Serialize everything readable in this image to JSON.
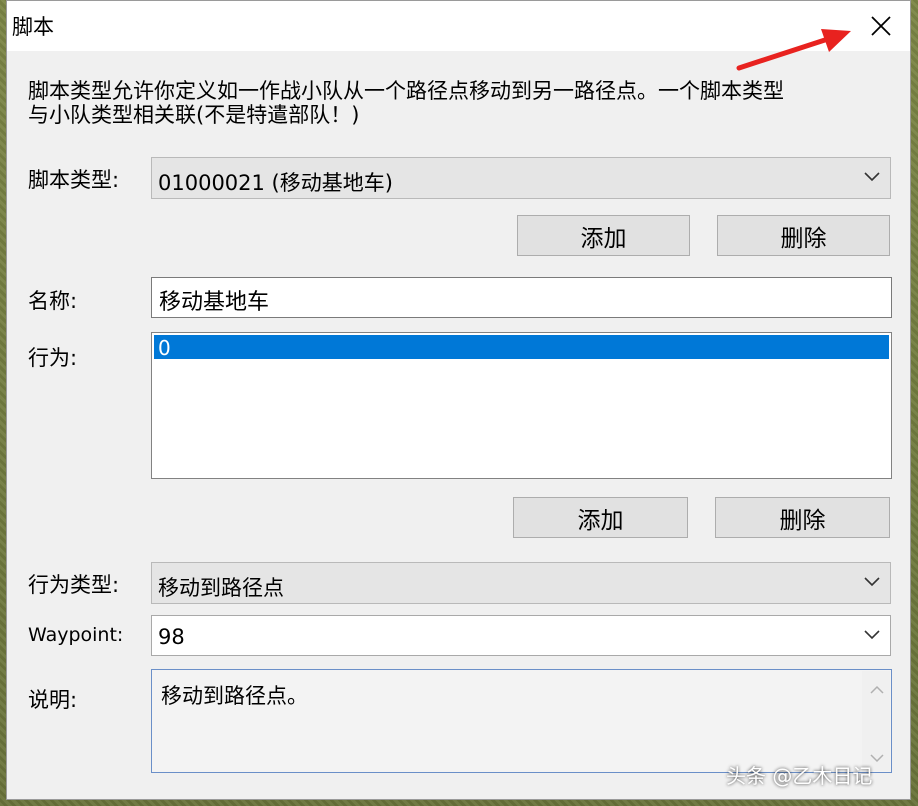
{
  "window": {
    "title": "脚本"
  },
  "description": "脚本类型允许你定义如一作战小队从一个路径点移动到另一路径点。一个脚本类型\n与小队类型相关联(不是特遣部队！)",
  "script_type": {
    "label": "脚本类型:",
    "value": "01000021 (移动基地车)"
  },
  "script_buttons": {
    "add": "添加",
    "delete": "删除"
  },
  "name": {
    "label": "名称:",
    "value": "移动基地车"
  },
  "actions": {
    "label": "行为:",
    "items": [
      "0"
    ],
    "selected_index": 0
  },
  "action_buttons": {
    "add": "添加",
    "delete": "删除"
  },
  "action_type": {
    "label": "行为类型:",
    "value": "移动到路径点"
  },
  "waypoint": {
    "label": "Waypoint:",
    "value": "98"
  },
  "explanation": {
    "label": "说明:",
    "value": "移动到路径点。"
  },
  "watermark": "头条 @乙木日记",
  "colors": {
    "selection": "#0078d7",
    "arrow": "#e8221f"
  }
}
